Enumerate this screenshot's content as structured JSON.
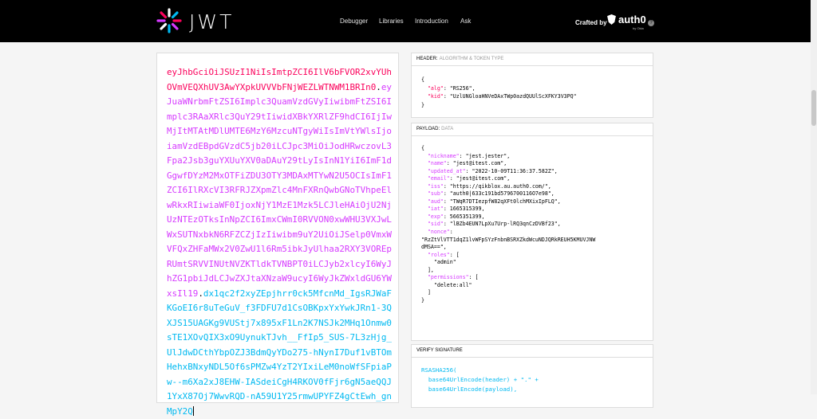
{
  "app": {
    "logo_text": "JWT"
  },
  "nav": [
    "Debugger",
    "Libraries",
    "Introduction",
    "Ask"
  ],
  "crafted": {
    "label": "Crafted by",
    "brand": "auth0",
    "sub": "by Okta"
  },
  "encoded": {
    "header": "eyJhbGciOiJSUzI1NiIsImtpZCI6IlV6bFVOR2xvYUhOVmVEQXhUV3AwYXpkUVVVbFNjWEZLWTNWM1BRIn0",
    "payload": "eyJuaWNrbmFtZSI6Implc3QuamVzdGVyIiwibmFtZSI6Implc3RAaXRlc3QuY29tIiwidXBkYXRlZF9hdCI6IjIwMjItMTAtMDlUMTE6MzY6MzcuNTgyWiIsImVtYWlsIjoiamVzdEBpdGVzdC5jb20iLCJpc3MiOiJodHRwczovL3Fpa2Jsb3guYXUuYXV0aDAuY29tLyIsInN1YiI6ImF1dGgwfDYzM2MxOTFiZDU3OTY3MDAxMTYwN2U5OCIsImF1ZCI6IlRXcVI3RFRJZXpmZlc4MnFXRnQwbGNoTVhpeElwRkxRIiwiaWF0IjoxNjY1MzE1Mzk5LCJleHAiOjU2NjUzNTEzOTksInNpZCI6ImxCWmI0RVVON0xwWHU3VXJwLWxSUTNxbkN6RFZCZjIzIiwibm9uY2UiOiJSelp0VmxWVFQxZHFaMWx2V0ZwU1l6Rm5ibkJyUlhaa2RXY3VOREpRUmtSRVVINUtNVZKTldkTVNBPT0iLCJyb2xlcyI6WyJhZG1pbiJdLCJwZXJtaXNzaW9ucyI6WyJkZWxldGU6YWxsIl19",
    "signature": "dx1qc2f2xyZEpjhrr0ck5MfcnMd_IgsRJWaFKGoEI6r8uTeGuV_f3FDFU7d1CsOBKpxYxYwkJRn1-3QXJS15UAGKg9VUStj7x895xF1Ln2K7NSJk2MHq1Onmw0sTE1XOvQIX3xO9UynukTJvh__FfIp5_SUS-7L3zHjg_UlJdwDCthYbpOZJ3BdmQyYDo275-hNynI7Duf1vBTOmHehxBNxyNDL5Of6sPMZw4YzT2YIxiLeM0noWfSFpiaPw--m6Xa2xJ8EHW-IASdeiCgH4RKOV0fFjr6gN5aeQQJ1YxX87Oj7WwvRQD-nA59U1Y25rmwUPYFZ4gCtEwh_gnMpY2Q"
  },
  "header_panel": {
    "title": "HEADER:",
    "subtitle": "ALGORITHM & TOKEN TYPE",
    "alg": "RS256",
    "kid": "UzlUNGloaHNVeDAxTWp0azdQUUlScXFKY3V3PQ"
  },
  "payload_panel": {
    "title": "PAYLOAD:",
    "subtitle": "DATA",
    "fields": [
      {
        "k": "nickname",
        "v": "\"jest.jester\","
      },
      {
        "k": "name",
        "v": "\"jest@itest.com\","
      },
      {
        "k": "updated_at",
        "v": "\"2022-10-09T11:36:37.582Z\","
      },
      {
        "k": "email",
        "v": "\"jest@itest.com\","
      },
      {
        "k": "iss",
        "v": "\"https://qikblox.au.auth0.com/\","
      },
      {
        "k": "sub",
        "v": "\"auth0|633c191bd5796700116O7e98\","
      },
      {
        "k": "aud",
        "v": "\"TWqR7DTIezpfW82qXFt0lchMXixIpFLQ\","
      },
      {
        "k": "iat",
        "v": "1665315399,"
      },
      {
        "k": "exp",
        "v": "5665351399,"
      },
      {
        "k": "sid",
        "v": "\"lBZb4EUN7LpXu7Urp-lRQ3qnCzDVBf23\","
      },
      {
        "k": "nonce",
        "v": ""
      }
    ],
    "nonce_value": "\"RzZtVlVTT1dqZ1lvWFpSYzFnbnBSRXZkdWcuNDJQRkREUH5KMUVJNW",
    "nonce_value2": "dMSA==\",",
    "roles_key": "roles",
    "roles_value": "\"admin\"",
    "perms_key": "permissions",
    "perms_value": "\"delete:all\""
  },
  "verify_panel": {
    "title": "VERIFY SIGNATURE",
    "line1": "RSASHA256(",
    "line2": "base64UrlEncode(header) + \".\" +",
    "line3": "base64UrlEncode(payload),"
  }
}
